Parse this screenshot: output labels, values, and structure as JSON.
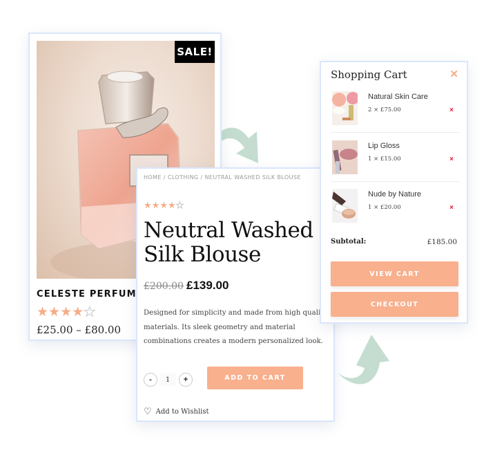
{
  "colors": {
    "accent": "#f8b08d",
    "star": "#f6ac88",
    "card_border": "#dbe6fb",
    "arrow": "#c4ddd0",
    "remove": "#e0192a",
    "sale_bg": "#000000"
  },
  "perfume_card": {
    "badge": "SALE!",
    "name": "CELESTE PERFUME",
    "rating": 4,
    "rating_max": 5,
    "price": "£25.00 – £80.00"
  },
  "product_detail": {
    "breadcrumb": "HOME / CLOTHING / NEUTRAL WASHED SILK BLOUSE",
    "rating": 4,
    "rating_max": 5,
    "title": "Neutral Washed Silk Blouse",
    "old_price": "£200.00",
    "new_price": "£139.00",
    "description": "Designed for simplicity and made from high quality materials. Its sleek geometry and material combinations creates a modern personalized look.",
    "quantity": "1",
    "qty_minus": "-",
    "qty_plus": "+",
    "add_to_cart": "ADD TO CART",
    "wishlist": "Add to Wishlist",
    "wishlist_icon": "heart-icon"
  },
  "cart": {
    "title": "Shopping Cart",
    "close_icon": "close-icon",
    "items": [
      {
        "name": "Natural Skin Care",
        "qty": "2 × £75.00",
        "remove": "×"
      },
      {
        "name": "Lip Gloss",
        "qty": "1 × £15.00",
        "remove": "×"
      },
      {
        "name": "Nude by Nature",
        "qty": "1 × £20.00",
        "remove": "×"
      }
    ],
    "subtotal_label": "Subtotal:",
    "subtotal_value": "£185.00",
    "view_cart": "VIEW CART",
    "checkout": "CHECKOUT"
  }
}
